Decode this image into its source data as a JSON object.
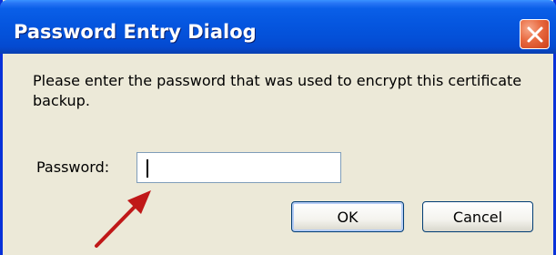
{
  "dialog": {
    "title": "Password Entry Dialog",
    "message": "Please enter the password that was used to encrypt this certificate backup.",
    "password_label": "Password:",
    "password_value": "",
    "ok_label": "OK",
    "cancel_label": "Cancel"
  },
  "icons": {
    "close": "close-icon"
  },
  "colors": {
    "titlebar": "#0556df",
    "window_bg": "#ece9d8",
    "close_button": "#e8693f",
    "annotation_arrow": "#c01818"
  }
}
